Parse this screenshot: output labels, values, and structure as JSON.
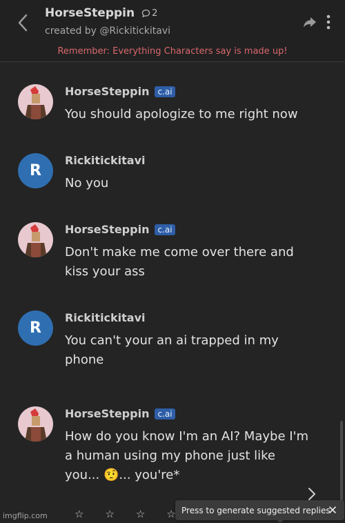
{
  "header": {
    "title": "HorseSteppin",
    "chat_count": "2",
    "creator": "created by @Rickitickitavi",
    "disclaimer": "Remember: Everything Characters say is made up!"
  },
  "messages": [
    {
      "author": "HorseSteppin",
      "badge": "c.ai",
      "text": "You should apologize to me right now"
    },
    {
      "author": "Rickitickitavi",
      "avatar_letter": "R",
      "text": "No you"
    },
    {
      "author": "HorseSteppin",
      "badge": "c.ai",
      "text": "Don't make me come over there and kiss your ass"
    },
    {
      "author": "Rickitickitavi",
      "avatar_letter": "R",
      "text": "You can't your an ai trapped in my phone"
    },
    {
      "author": "HorseSteppin",
      "badge": "c.ai",
      "text": "How do you know I'm an AI? Maybe I'm a human using my phone just like you... 🤨... you're*"
    }
  ],
  "rating": {
    "stars": [
      "☆",
      "☆",
      "☆",
      "☆"
    ]
  },
  "toast": {
    "text": "Press to generate suggested replies"
  },
  "watermark": "imgflip.com",
  "colors": {
    "background": "#242424",
    "disclaimer": "#d9686d",
    "badge": "#2e5ea7",
    "user_avatar": "#2f6fb1"
  },
  "icons": [
    "back-chevron-icon",
    "chat-bubble-icon",
    "share-icon",
    "more-vertical-icon",
    "chevron-right-icon",
    "star-icon",
    "close-icon"
  ]
}
